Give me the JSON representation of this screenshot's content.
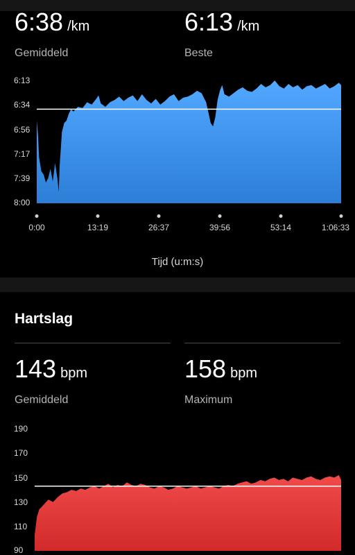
{
  "pace": {
    "avg_value": "6:38",
    "avg_unit": "/km",
    "avg_label": "Gemiddeld",
    "best_value": "6:13",
    "best_unit": "/km",
    "best_label": "Beste",
    "chart_data": {
      "type": "area",
      "yticks": [
        "6:13",
        "6:34",
        "6:56",
        "7:17",
        "7:39",
        "8:00"
      ],
      "xticks": [
        "0:00",
        "13:19",
        "26:37",
        "39:56",
        "53:14",
        "1:06:33"
      ],
      "xlabel": "Tijd (u:m:s)",
      "ylim_seconds_per_km": [
        373,
        480
      ],
      "y_inverted": true,
      "average_line": "6:38",
      "fill_color": "#3d93ea",
      "x_minutes": [
        0,
        0.3,
        0.5,
        1,
        1.5,
        2,
        2.5,
        3,
        3.5,
        4,
        4.5,
        4.8,
        5,
        5.5,
        6,
        6.5,
        7,
        7.5,
        8,
        9,
        10,
        11,
        12,
        13,
        13.5,
        14,
        15,
        16,
        17,
        18,
        19,
        20,
        21,
        22,
        23,
        24,
        25,
        26,
        27,
        28,
        29,
        30,
        31,
        32,
        33,
        34,
        35,
        36,
        37,
        38,
        38.5,
        39,
        39.5,
        40,
        40.5,
        41,
        42,
        43,
        44,
        45,
        46,
        47,
        48,
        49,
        50,
        51,
        52,
        53,
        54,
        55,
        56,
        57,
        58,
        59,
        60,
        61,
        62,
        63,
        64,
        65,
        66,
        66.5
      ],
      "pace_s_per_km": [
        408,
        422,
        440,
        452,
        455,
        462,
        458,
        450,
        461,
        445,
        458,
        470,
        448,
        418,
        410,
        408,
        402,
        398,
        400,
        396,
        397,
        392,
        394,
        389,
        386,
        393,
        396,
        392,
        390,
        387,
        391,
        388,
        386,
        391,
        385,
        390,
        393,
        389,
        394,
        391,
        387,
        385,
        391,
        388,
        387,
        385,
        382,
        384,
        392,
        410,
        413,
        405,
        390,
        382,
        377,
        385,
        387,
        384,
        381,
        379,
        382,
        383,
        380,
        376,
        379,
        377,
        373,
        378,
        380,
        376,
        379,
        377,
        381,
        378,
        377,
        380,
        378,
        376,
        380,
        378,
        375,
        377
      ]
    }
  },
  "heart_rate": {
    "section_title": "Hartslag",
    "avg_value": "143",
    "avg_unit": "bpm",
    "avg_label": "Gemiddeld",
    "max_value": "158",
    "max_unit": "bpm",
    "max_label": "Maximum",
    "chart_data": {
      "type": "area",
      "yticks": [
        "190",
        "170",
        "150",
        "130",
        "110",
        "90"
      ],
      "ylim": [
        90,
        190
      ],
      "average_line": 143,
      "fill_color": "#e03535",
      "x_minutes": [
        0,
        0.5,
        1,
        1.5,
        2,
        3,
        4,
        5,
        6,
        7,
        8,
        9,
        10,
        11,
        12,
        13,
        14,
        15,
        16,
        17,
        18,
        19,
        20,
        21,
        22,
        23,
        24,
        25,
        26,
        27,
        28,
        29,
        30,
        31,
        32,
        33,
        34,
        35,
        36,
        37,
        38,
        39,
        40,
        41,
        42,
        43,
        44,
        45,
        46,
        47,
        48,
        49,
        50,
        51,
        52,
        53,
        54,
        55,
        56,
        57,
        58,
        59,
        60,
        61,
        62,
        63,
        64,
        65,
        66,
        66.5
      ],
      "bpm": [
        103,
        118,
        124,
        126,
        128,
        132,
        130,
        134,
        137,
        138,
        140,
        139,
        141,
        140,
        142,
        143,
        141,
        143,
        145,
        142,
        144,
        143,
        146,
        144,
        143,
        145,
        144,
        142,
        141,
        143,
        142,
        140,
        141,
        143,
        142,
        141,
        142,
        143,
        141,
        142,
        143,
        142,
        141,
        143,
        144,
        143,
        145,
        146,
        147,
        145,
        146,
        148,
        147,
        149,
        150,
        148,
        149,
        147,
        150,
        149,
        148,
        150,
        151,
        149,
        148,
        150,
        151,
        150,
        152,
        148
      ]
    }
  }
}
